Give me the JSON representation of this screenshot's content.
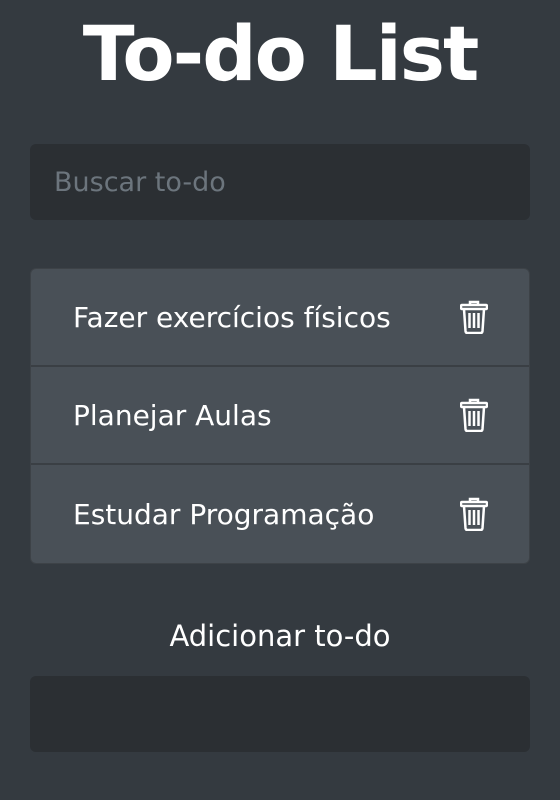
{
  "page": {
    "title": "To-do List"
  },
  "search": {
    "placeholder": "Buscar to-do",
    "value": ""
  },
  "todos": [
    {
      "label": "Fazer exercícios físicos",
      "icon": "trash-icon"
    },
    {
      "label": "Planejar Aulas",
      "icon": "trash-icon"
    },
    {
      "label": "Estudar Programação",
      "icon": "trash-icon"
    }
  ],
  "add": {
    "label": "Adicionar to-do",
    "value": ""
  },
  "colors": {
    "background": "#343a40",
    "input_background": "#2b2f33",
    "list_item_background": "#495057",
    "text": "#ffffff",
    "placeholder": "#6c757d"
  }
}
